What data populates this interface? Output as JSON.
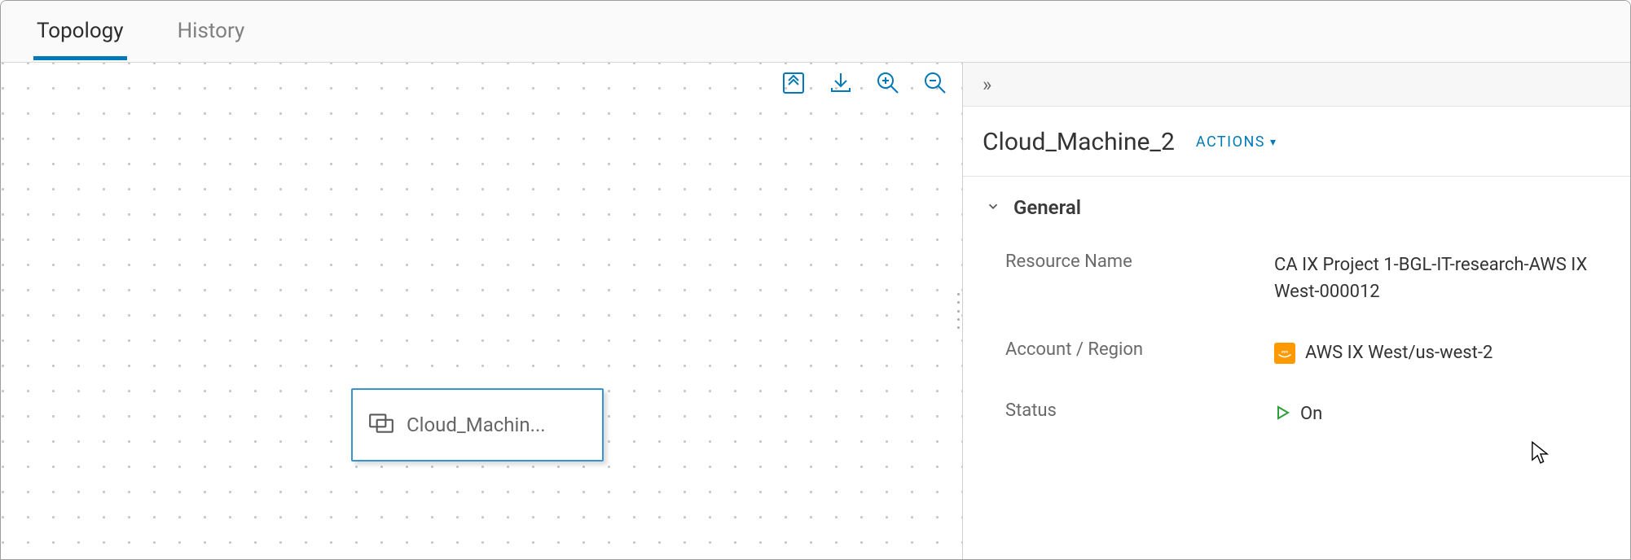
{
  "tabs": {
    "topology": "Topology",
    "history": "History"
  },
  "canvas": {
    "node_label": "Cloud_Machin..."
  },
  "panel": {
    "title": "Cloud_Machine_2",
    "actions_label": "ACTIONS",
    "sections": {
      "general": {
        "title": "General",
        "resource_name_label": "Resource Name",
        "resource_name_value": "CA IX Project 1-BGL-IT-research-AWS IX West-000012",
        "account_region_label": "Account / Region",
        "account_region_value": "AWS IX West/us-west-2",
        "status_label": "Status",
        "status_value": "On"
      }
    }
  }
}
